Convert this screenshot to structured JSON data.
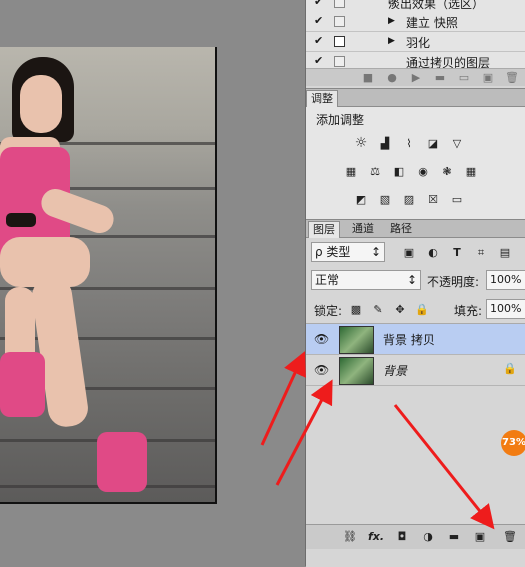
{
  "history": {
    "rows": [
      {
        "label": "淡出效果（选区）"
      },
      {
        "label": "建立 快照"
      },
      {
        "label": "羽化"
      },
      {
        "label": "通过拷贝的图层"
      }
    ]
  },
  "adjust": {
    "tab": "调整",
    "title": "添加调整"
  },
  "layers": {
    "tabs": [
      "图层",
      "通道",
      "路径"
    ],
    "filter_label": "ρ 类型",
    "blend_mode": "正常",
    "opacity_label": "不透明度:",
    "opacity_value": "100%",
    "lock_label": "锁定:",
    "fill_label": "填充:",
    "fill_value": "100%",
    "items": [
      {
        "name": "背景 拷贝",
        "selected": true
      },
      {
        "name": "背景",
        "selected": false,
        "locked": true
      }
    ],
    "badge": "73%",
    "footer_icons": [
      "link-icon",
      "fx-icon",
      "mask-icon",
      "adjustment-icon",
      "group-icon",
      "new-layer-icon",
      "delete-icon"
    ],
    "footer_fx": "fx."
  },
  "colors": {
    "selected_row": "#b9cdf2",
    "arrow": "#ee1c1c",
    "badge": "#f27c12"
  }
}
